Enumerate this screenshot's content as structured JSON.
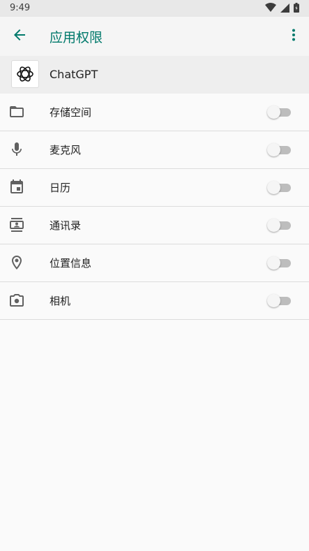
{
  "status_bar": {
    "time": "9:49",
    "icons": [
      "wifi-icon",
      "signal-icon",
      "battery-icon"
    ]
  },
  "app_bar": {
    "title": "应用权限",
    "back_icon": "back-arrow-icon",
    "menu_icon": "more-vert-icon"
  },
  "app_info": {
    "name": "ChatGPT",
    "icon": "chatgpt-logo-icon"
  },
  "permissions": [
    {
      "label": "存储空间",
      "icon": "folder-icon",
      "enabled": false
    },
    {
      "label": "麦克风",
      "icon": "microphone-icon",
      "enabled": false
    },
    {
      "label": "日历",
      "icon": "calendar-icon",
      "enabled": false
    },
    {
      "label": "通讯录",
      "icon": "contacts-icon",
      "enabled": false
    },
    {
      "label": "位置信息",
      "icon": "location-icon",
      "enabled": false
    },
    {
      "label": "相机",
      "icon": "camera-icon",
      "enabled": false
    }
  ],
  "colors": {
    "accent": "#00796b",
    "icon": "#616161",
    "switch_off_track": "#bdbdbd",
    "switch_off_thumb": "#f5f5f5"
  }
}
